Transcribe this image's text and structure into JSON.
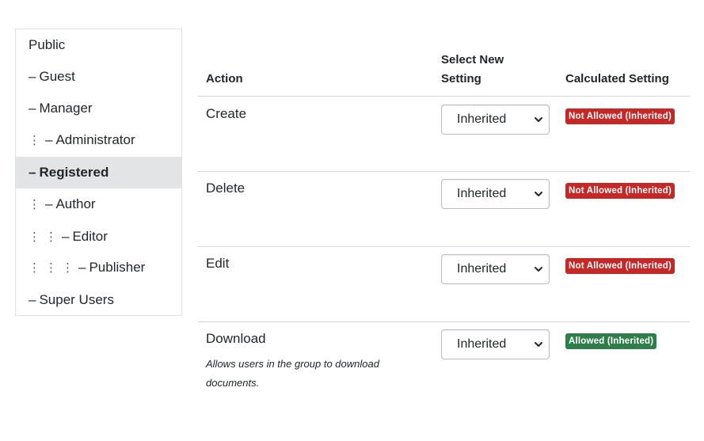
{
  "groups": [
    {
      "label": "Public",
      "depth": 0,
      "dash": false,
      "active": false
    },
    {
      "label": "Guest",
      "depth": 0,
      "dash": true,
      "active": false
    },
    {
      "label": "Manager",
      "depth": 0,
      "dash": true,
      "active": false
    },
    {
      "label": "Administrator",
      "depth": 1,
      "dash": true,
      "active": false
    },
    {
      "label": "Registered",
      "depth": 0,
      "dash": true,
      "active": true
    },
    {
      "label": "Author",
      "depth": 1,
      "dash": true,
      "active": false
    },
    {
      "label": "Editor",
      "depth": 2,
      "dash": true,
      "active": false
    },
    {
      "label": "Publisher",
      "depth": 3,
      "dash": true,
      "active": false
    },
    {
      "label": "Super Users",
      "depth": 0,
      "dash": true,
      "active": false
    }
  ],
  "table": {
    "headers": {
      "action": "Action",
      "select_line1": "Select New",
      "select_line2": "Setting",
      "calculated": "Calculated Setting"
    },
    "rows": [
      {
        "action": "Create",
        "description": "",
        "setting": "Inherited",
        "calculated": "Not Allowed (Inherited)",
        "status": "denied"
      },
      {
        "action": "Delete",
        "description": "",
        "setting": "Inherited",
        "calculated": "Not Allowed (Inherited)",
        "status": "denied"
      },
      {
        "action": "Edit",
        "description": "",
        "setting": "Inherited",
        "calculated": "Not Allowed (Inherited)",
        "status": "denied"
      },
      {
        "action": "Download",
        "description": "Allows users in the group to download documents.",
        "setting": "Inherited",
        "calculated": "Allowed (Inherited)",
        "status": "allowed"
      }
    ]
  },
  "icons": {
    "tree_indent": "vertical-ellipsis-icon",
    "select_arrow": "chevron-down-icon"
  },
  "colors": {
    "denied": "#c52827",
    "allowed": "#2f7d4a",
    "active_row": "#e3e4e5",
    "border": "#d4d8dc"
  }
}
